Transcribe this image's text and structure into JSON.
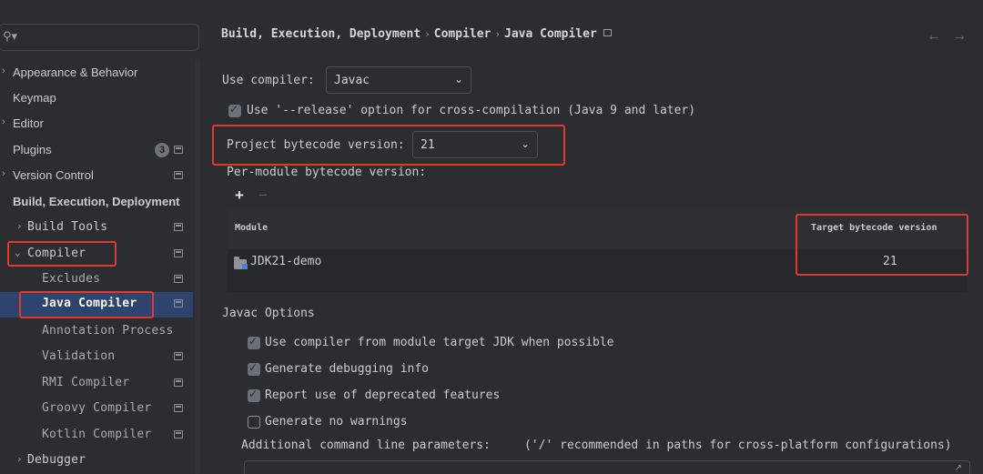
{
  "search": {
    "icon": "search-icon",
    "placeholder": ""
  },
  "sidebar": {
    "items": [
      {
        "label": "Appearance & Behavior",
        "expandable": true
      },
      {
        "label": "Keymap"
      },
      {
        "label": "Editor",
        "expandable": true
      },
      {
        "label": "Plugins",
        "badge": "3"
      },
      {
        "label": "Version Control",
        "expandable": true
      },
      {
        "label": "Build, Execution, Deployment",
        "expanded": true
      },
      {
        "label": "Build Tools",
        "expandable": true
      },
      {
        "label": "Compiler",
        "expanded": true
      },
      {
        "label": "Excludes"
      },
      {
        "label": "Java Compiler",
        "selected": true
      },
      {
        "label": "Annotation Process"
      },
      {
        "label": "Validation"
      },
      {
        "label": "RMI Compiler"
      },
      {
        "label": "Groovy Compiler"
      },
      {
        "label": "Kotlin Compiler"
      },
      {
        "label": "Debugger",
        "expandable": true
      }
    ]
  },
  "breadcrumb": {
    "items": [
      "Build, Execution, Deployment",
      "Compiler",
      "Java Compiler"
    ],
    "separator": "›"
  },
  "nav": {
    "back": "←",
    "forward": "→"
  },
  "form": {
    "use_compiler_label": "Use compiler:",
    "use_compiler_value": "Javac",
    "release_option_label": "Use '--release' option for cross-compilation (Java 9 and later)",
    "release_option_checked": true,
    "project_bytecode_label": "Project bytecode version:",
    "project_bytecode_value": "21",
    "per_module_label": "Per-module bytecode version:",
    "add_label": "+",
    "remove_label": "−"
  },
  "module_table": {
    "columns": [
      "Module",
      "Target bytecode version"
    ],
    "rows": [
      {
        "module": "JDK21-demo",
        "target": "21"
      }
    ]
  },
  "javac_options": {
    "title": "Javac Options",
    "options": [
      {
        "label": "Use compiler from module target JDK when possible",
        "checked": true
      },
      {
        "label": "Generate debugging info",
        "checked": true
      },
      {
        "label": "Report use of deprecated features",
        "checked": true
      },
      {
        "label": "Generate no warnings",
        "checked": false
      }
    ],
    "params_label": "Additional command line parameters:",
    "params_hint": "('/' recommended in paths for cross-platform configurations)",
    "params_value": ""
  },
  "colors": {
    "background": "#2b2d30",
    "selection": "#2e436e",
    "highlight_annotation": "#e03a2f",
    "checkbox": "#6b6f77"
  }
}
